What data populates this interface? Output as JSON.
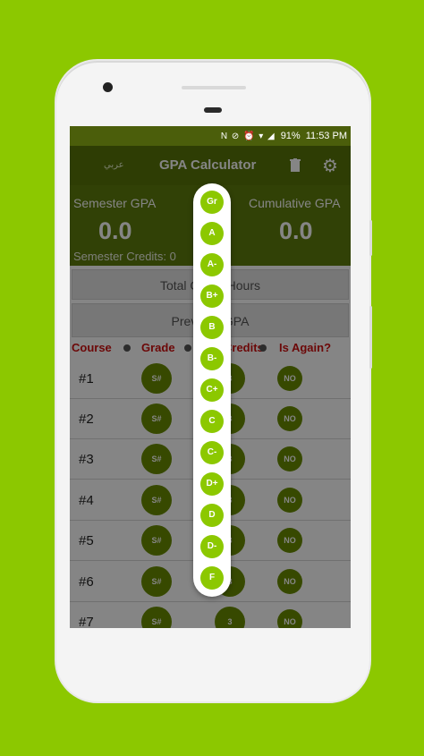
{
  "status_bar": {
    "icons": "N ⊘ ⏰ ▾ ◢",
    "battery": "91%",
    "time": "11:53 PM"
  },
  "app_bar": {
    "language": "عربي",
    "title": "GPA Calculator",
    "trash_icon": "trash-icon",
    "settings_icon": "gear-icon"
  },
  "summary": {
    "semester_gpa_label": "Semester GPA",
    "semester_gpa_value": "0.0",
    "cumulative_gpa_label": "Cumulative GPA",
    "cumulative_gpa_value": "0.0",
    "semester_credits_label": "Semester Credits: 0"
  },
  "buttons": {
    "total_hours": "Total Credit Hours",
    "gpa": "Previous GPA"
  },
  "table": {
    "headers": [
      "Course",
      "Grade",
      "Credits",
      "Is Again?"
    ],
    "rows": [
      {
        "num": "#1",
        "grade": "S#",
        "credits": "3",
        "again": "NO"
      },
      {
        "num": "#2",
        "grade": "S#",
        "credits": "3",
        "again": "NO"
      },
      {
        "num": "#3",
        "grade": "S#",
        "credits": "3",
        "again": "NO"
      },
      {
        "num": "#4",
        "grade": "S#",
        "credits": "3",
        "again": "NO"
      },
      {
        "num": "#5",
        "grade": "S#",
        "credits": "3",
        "again": "NO"
      },
      {
        "num": "#6",
        "grade": "S#",
        "credits": "3",
        "again": "NO"
      },
      {
        "num": "#7",
        "grade": "S#",
        "credits": "3",
        "again": "NO"
      }
    ]
  },
  "grade_picker": {
    "options": [
      "Gr",
      "A",
      "A-",
      "B+",
      "B",
      "B-",
      "C+",
      "C",
      "C-",
      "D+",
      "D",
      "D-",
      "F"
    ]
  },
  "colors": {
    "background": "#8cc800",
    "app_bar": "#587509",
    "summary": "#5f7d0c",
    "accent": "#8cc800",
    "header_text": "#d01010"
  }
}
